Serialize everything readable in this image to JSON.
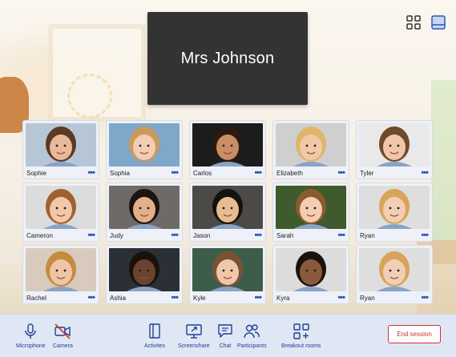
{
  "teacher": {
    "name": "Mrs Johnson"
  },
  "view_buttons": [
    {
      "name": "grid-view-icon"
    },
    {
      "name": "speaker-view-icon"
    }
  ],
  "participants": [
    {
      "name": "Sophie",
      "skin": "#e8b99a",
      "hair": "#5a3a26",
      "bg": "#b7c6d6"
    },
    {
      "name": "Sophia",
      "skin": "#f1cdb4",
      "hair": "#c99a5a",
      "bg": "#7fa7c9"
    },
    {
      "name": "Carlos",
      "skin": "#c98e66",
      "hair": "#2a1a12",
      "bg": "#1c1c1c"
    },
    {
      "name": "Elizabeth",
      "skin": "#f0c9a9",
      "hair": "#e0b56a",
      "bg": "#cfcfcf"
    },
    {
      "name": "Tyler",
      "skin": "#f0c7a8",
      "hair": "#6e4a2c",
      "bg": "#e9e9e9"
    },
    {
      "name": "Cameron",
      "skin": "#f1c8a9",
      "hair": "#a0612f",
      "bg": "#dcdcdc"
    },
    {
      "name": "Judy",
      "skin": "#e1b08c",
      "hair": "#1d140f",
      "bg": "#6e6a68"
    },
    {
      "name": "Jason",
      "skin": "#e7bc92",
      "hair": "#15110e",
      "bg": "#4c4a47"
    },
    {
      "name": "Sarah",
      "skin": "#f2cdb3",
      "hair": "#8b5a2e",
      "bg": "#3f5a2c"
    },
    {
      "name": "Ryan",
      "skin": "#f1cfb6",
      "hair": "#d8a35a",
      "bg": "#dedede"
    },
    {
      "name": "Rachel",
      "skin": "#f0c4a6",
      "hair": "#c58b3f",
      "bg": "#d8cbbd"
    },
    {
      "name": "Ashia",
      "skin": "#6a4330",
      "hair": "#1a110c",
      "bg": "#2b2f36"
    },
    {
      "name": "Kyle",
      "skin": "#f0c7a8",
      "hair": "#7b5231",
      "bg": "#3d5d4b"
    },
    {
      "name": "Kyra",
      "skin": "#8a5a3c",
      "hair": "#1b120d",
      "bg": "#dcdcdc"
    },
    {
      "name": "Ryan",
      "skin": "#f1cfb6",
      "hair": "#d8a35a",
      "bg": "#dedede"
    }
  ],
  "more_label": "•••",
  "toolbar": {
    "microphone": "Microphone",
    "camera": "Camera",
    "activities": "Activites",
    "screenshare": "Screenshare",
    "chat": "Chat",
    "participants": "Participants",
    "breakout": "Breakout rooms",
    "end_session": "End session"
  },
  "colors": {
    "accent": "#2a55b8",
    "danger": "#d23030",
    "toolbar_bg": "#dfe7f5"
  }
}
